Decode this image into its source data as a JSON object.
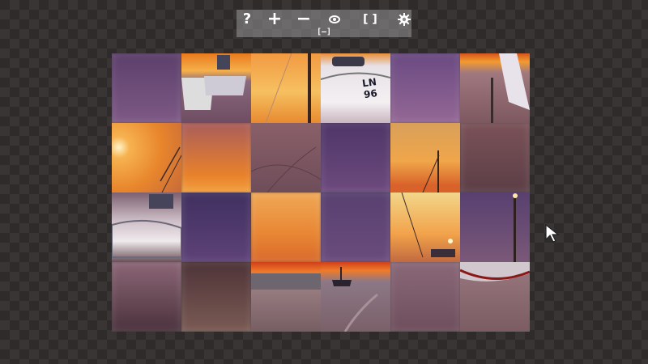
{
  "toolbar": {
    "help_label": "?",
    "zoom_in_label": "+",
    "zoom_out_label": "−",
    "fullscreen_label": "[ ]",
    "border_label": "[—]",
    "icons": {
      "help": "question-icon",
      "zoom_in": "plus-icon",
      "zoom_out": "minus-icon",
      "preview": "eye-icon",
      "fullscreen": "fullscreen-icon",
      "settings": "gear-icon",
      "border": "border-toggle-icon"
    }
  },
  "boat_registration": "LN 96",
  "board": {
    "rows": 4,
    "cols": 6,
    "tiles": [
      [
        "purple-sky",
        "boats-sunset",
        "sunset-mast",
        "boat-hull-ln",
        "purple-sky-light",
        "boat-bow-right"
      ],
      [
        "sunburst-rigging",
        "orange-sky",
        "sand-tracks",
        "purple-sky-dark",
        "sunset-masts",
        "pink-sand"
      ],
      [
        "white-boat-hull",
        "purple-sky-dark",
        "orange-sky",
        "purple-sky-dark",
        "sun-rigging",
        "purple-sky-pole"
      ],
      [
        "pink-sand-dark",
        "dark-sand",
        "sea-wall-graffiti",
        "boat-on-beach",
        "pink-sand",
        "boat-keel-sand"
      ]
    ]
  },
  "colors": {
    "toolbar_bg": "#969696",
    "purple_sky": "#6a4a78",
    "orange_sky": "#e9892f",
    "sand": "#7a5a5e"
  }
}
